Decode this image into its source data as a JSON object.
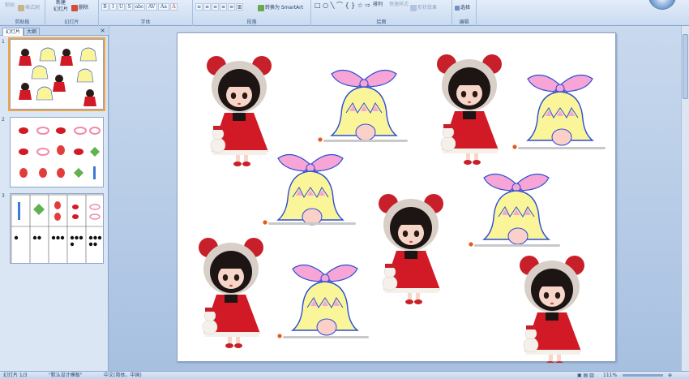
{
  "ribbon": {
    "clipboard": {
      "paste": "粘贴",
      "format_painter": "格式刷",
      "group_label": "剪贴板"
    },
    "slides": {
      "new_slide_line1": "新建",
      "new_slide_line2": "幻灯片",
      "delete": "删除",
      "group_label": "幻灯片"
    },
    "font": {
      "group_label": "字体",
      "buttons": [
        "B",
        "I",
        "U",
        "S",
        "abc",
        "AV",
        "Aa",
        "A"
      ]
    },
    "paragraph": {
      "convert_smartart": "转换为 SmartArt",
      "group_label": "段落"
    },
    "drawing": {
      "arrange": "排列",
      "quick_styles": "快速样式",
      "shape_effects": "形状效果",
      "group_label": "绘图"
    },
    "editing": {
      "select": "选择",
      "group_label": "编辑"
    }
  },
  "left_pane": {
    "tabs": [
      "幻灯片",
      "大纲"
    ],
    "close_glyph": "×",
    "slide_numbers": [
      "1",
      "2",
      "3"
    ],
    "thumb3_dot_counts": [
      1,
      2,
      3,
      4,
      5
    ]
  },
  "status_bar": {
    "slide_info": "幻灯片 1/3",
    "theme": "\"默认设计模板\"",
    "language": "中文(简体，中国)",
    "zoom": "111%"
  },
  "colors": {
    "ribbon_bg": "#dbe7f7",
    "selection": "#f3a43c",
    "bell_fill": "#fbf59a",
    "bow_fill": "#f7a4d6",
    "outline": "#2a4fd4",
    "doll_red": "#d21a26"
  }
}
